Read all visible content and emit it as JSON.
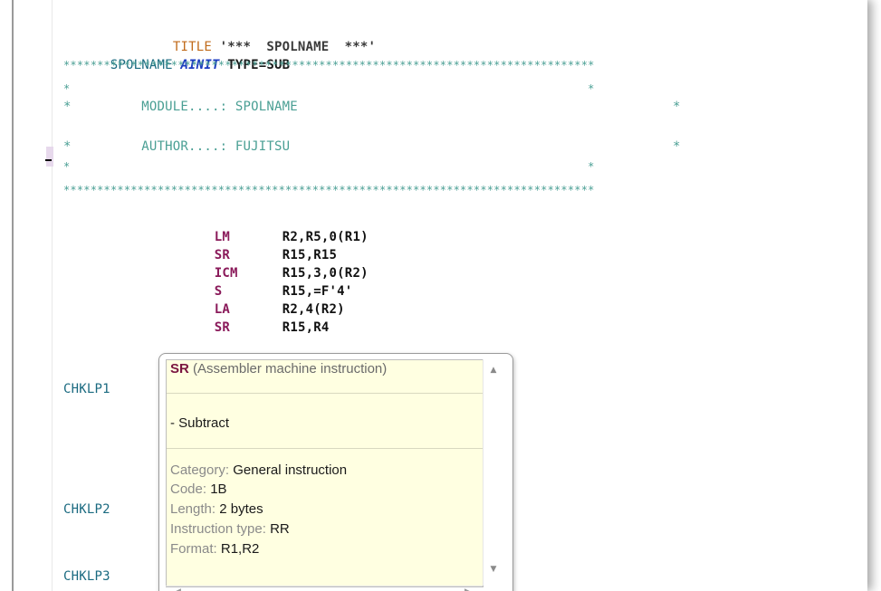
{
  "editor": {
    "lines": [
      {
        "indent": "        ",
        "title_kw": "TITLE",
        "title_str": " '*** ",
        "title_name": " SPOLNAME ",
        "title_end": " ***'"
      },
      {
        "label": "SPOLNAME",
        "macro": "AINIT",
        "operand": "TYPE=SUB"
      },
      {
        "comment": "*******************************************************************************"
      },
      {
        "comment": "*                                                                             *"
      },
      {
        "comment": "*         MODULE....: SPOLNAME                                                *"
      },
      {
        "comment": "*         AUTHOR....: FUJITSU                                                 *"
      },
      {
        "comment": "*                                                                             *"
      },
      {
        "comment": "*******************************************************************************"
      }
    ],
    "instructions": [
      {
        "opcode": "LM",
        "args": "R2,R5,0(R1)"
      },
      {
        "opcode": "SR",
        "args": "R15,R15"
      },
      {
        "opcode": "ICM",
        "args": "R15,3,0(R2)"
      },
      {
        "opcode": "S",
        "args": "R15,=F'4'"
      },
      {
        "opcode": "LA",
        "args": "R2,4(R2)"
      },
      {
        "opcode": "SR",
        "args": "R15,R4"
      }
    ],
    "labels": [
      "CHKLP1",
      "CHKLP2",
      "CHKLP3"
    ]
  },
  "tooltip": {
    "opcode": "SR",
    "subtitle": "(Assembler machine instruction)",
    "description": "- Subtract",
    "category_label": "Category:",
    "category_value": "General instruction",
    "code_label": "Code:",
    "code_value": "1B",
    "length_label": "Length:",
    "length_value": "2 bytes",
    "type_label": "Instruction type:",
    "type_value": "RR",
    "format_label": "Format:",
    "format_value": "R1,R2"
  },
  "icons": [
    "scroll-up-arrow",
    "scroll-down-arrow",
    "scroll-left-arrow",
    "scroll-right-arrow"
  ]
}
